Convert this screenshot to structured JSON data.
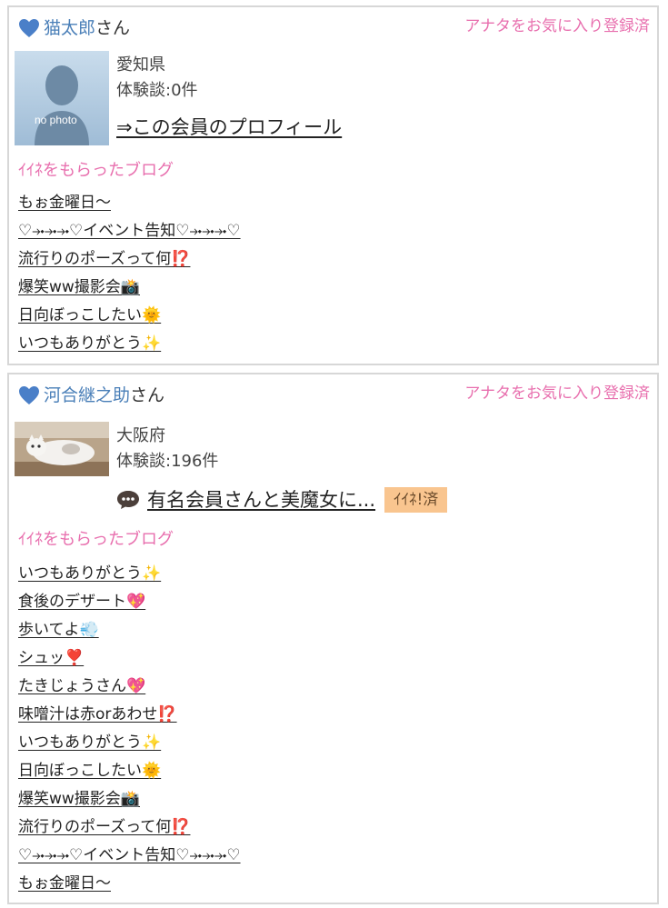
{
  "cards": [
    {
      "member_name": "猫太郎",
      "san": "さん",
      "favorite_status": "アナタをお気に入り登録済",
      "avatar_text": "no photo",
      "prefecture": "愛知県",
      "reviews": "体験談:0件",
      "profile_link": "⇒この会員のプロフィール",
      "blog_heading": "ｲｲﾈをもらったブログ",
      "blogs": [
        "もぉ金曜日〜",
        "♡⤞⤞⤞♡イベント告知♡⤞⤞⤞♡",
        "流行りのポーズって何⁉️",
        "爆笑ww撮影会📸",
        "日向ぼっこしたい🌞",
        "いつもありがとう✨"
      ]
    },
    {
      "member_name": "河合継之助",
      "san": "さん",
      "favorite_status": "アナタをお気に入り登録済",
      "prefecture": "大阪府",
      "reviews": "体験談:196件",
      "review_link": "有名会員さんと美魔女に...",
      "iine_badge": "ｲｲﾈ!済",
      "blog_heading": "ｲｲﾈをもらったブログ",
      "blogs": [
        "いつもありがとう✨",
        "食後のデザート💖",
        "歩いてよ💨",
        "シュッ❣️",
        "たきじょうさん💖",
        "味噌汁は赤orあわせ⁉️",
        "いつもありがとう✨",
        "日向ぼっこしたい🌞",
        "爆笑ww撮影会📸",
        "流行りのポーズって何⁉️",
        "♡⤞⤞⤞♡イベント告知♡⤞⤞⤞♡",
        "もぉ金曜日〜"
      ]
    }
  ],
  "colors": {
    "heart": "#4a7fc8",
    "name": "#4a7fb8",
    "pink_accent": "#e86fae",
    "badge": "#f9c58f",
    "border": "#d7d7d7"
  },
  "icons": {
    "heart": "heart-icon",
    "bubble": "speech-bubble-icon",
    "no_photo": "no-photo-silhouette"
  }
}
